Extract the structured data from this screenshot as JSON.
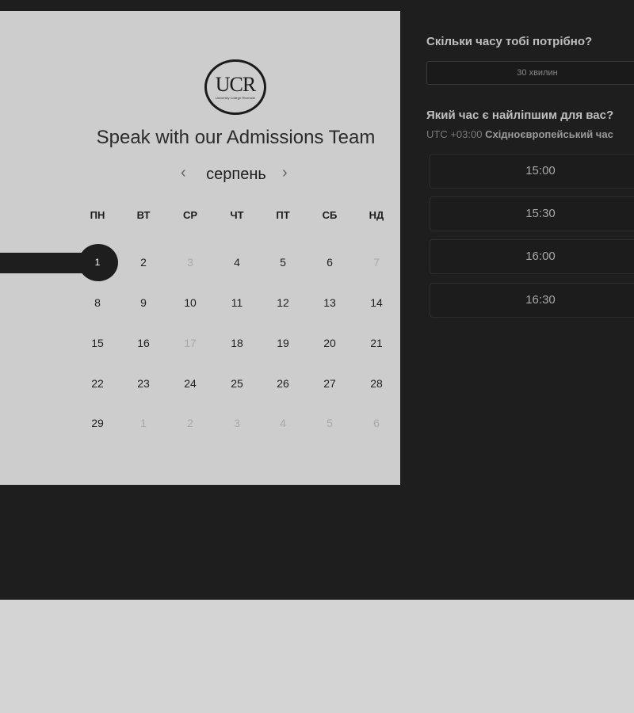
{
  "panel": {
    "logo_text": "UCR",
    "logo_subtext": "University College Riverside",
    "title": "Speak with our Admissions Team"
  },
  "calendar": {
    "month": "серпень",
    "prev_symbol": "‹",
    "next_symbol": "›",
    "weekdays": [
      "ПН",
      "ВТ",
      "СР",
      "ЧТ",
      "ПТ",
      "СБ",
      "НД"
    ],
    "selected_day": "1",
    "days": [
      {
        "label": "1",
        "state": "selected"
      },
      {
        "label": "2",
        "state": "available"
      },
      {
        "label": "3",
        "state": "unavailable"
      },
      {
        "label": "4",
        "state": "available"
      },
      {
        "label": "5",
        "state": "available"
      },
      {
        "label": "6",
        "state": "available"
      },
      {
        "label": "7",
        "state": "unavailable"
      },
      {
        "label": "8",
        "state": "available"
      },
      {
        "label": "9",
        "state": "available"
      },
      {
        "label": "10",
        "state": "available"
      },
      {
        "label": "11",
        "state": "available"
      },
      {
        "label": "12",
        "state": "available"
      },
      {
        "label": "13",
        "state": "available"
      },
      {
        "label": "14",
        "state": "available"
      },
      {
        "label": "15",
        "state": "available"
      },
      {
        "label": "16",
        "state": "available"
      },
      {
        "label": "17",
        "state": "unavailable"
      },
      {
        "label": "18",
        "state": "available"
      },
      {
        "label": "19",
        "state": "available"
      },
      {
        "label": "20",
        "state": "available"
      },
      {
        "label": "21",
        "state": "available"
      },
      {
        "label": "22",
        "state": "available"
      },
      {
        "label": "23",
        "state": "available"
      },
      {
        "label": "24",
        "state": "available"
      },
      {
        "label": "25",
        "state": "available"
      },
      {
        "label": "26",
        "state": "available"
      },
      {
        "label": "27",
        "state": "available"
      },
      {
        "label": "28",
        "state": "available"
      },
      {
        "label": "29",
        "state": "available"
      },
      {
        "label": "1",
        "state": "outside"
      },
      {
        "label": "2",
        "state": "outside"
      },
      {
        "label": "3",
        "state": "outside"
      },
      {
        "label": "4",
        "state": "outside"
      },
      {
        "label": "5",
        "state": "outside"
      },
      {
        "label": "6",
        "state": "outside"
      }
    ]
  },
  "booking": {
    "duration_question": "Скільки часу тобі потрібно?",
    "duration_value": "30 хвилин",
    "time_question": "Який час є найліпшим для вас?",
    "timezone_offset": "UTC +03:00",
    "timezone_name": "Східноєвропейський час",
    "time_slots": [
      "15:00",
      "15:30",
      "16:00",
      "16:30"
    ]
  },
  "colors": {
    "dark": "#1e1e1e",
    "calendar_bg": "#cdcdcd",
    "page_bg": "#d4d4d4",
    "muted_day": "#a9a9a9"
  }
}
